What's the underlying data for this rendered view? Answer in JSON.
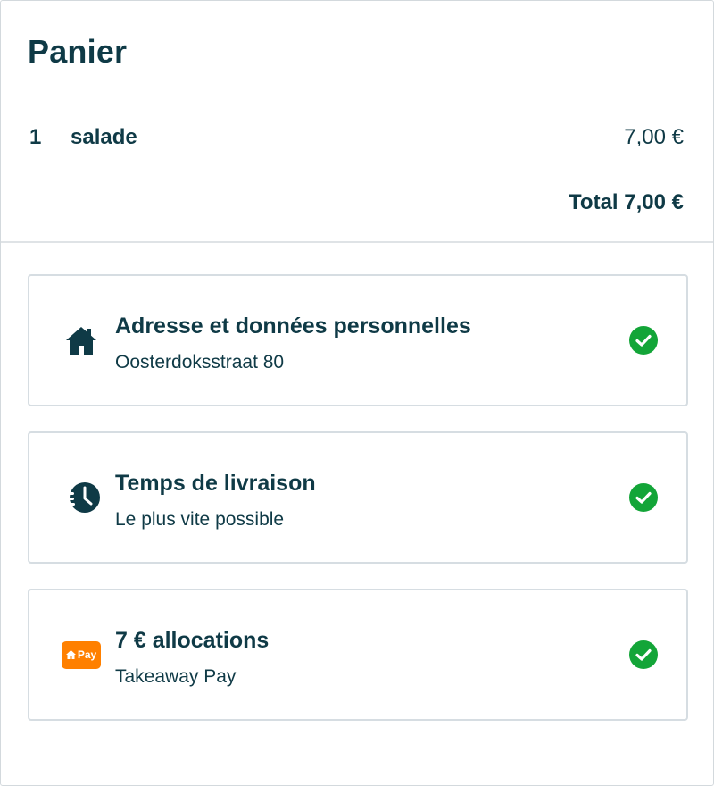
{
  "basket": {
    "title": "Panier",
    "items": [
      {
        "quantity": "1",
        "name": "salade",
        "price": "7,00 €"
      }
    ],
    "total": "Total 7,00 €"
  },
  "steps": [
    {
      "title": "Adresse et données personnelles",
      "subtitle": "Oosterdoksstraat 80",
      "icon": "house-icon",
      "status": "complete"
    },
    {
      "title": "Temps de livraison",
      "subtitle": "Le plus vite possible",
      "icon": "fast-clock-icon",
      "status": "complete"
    },
    {
      "title": "7 € allocations",
      "subtitle": "Takeaway Pay",
      "icon": "takeaway-pay-icon",
      "icon_label": "Pay",
      "status": "complete"
    }
  ],
  "colors": {
    "text": "#0f3a46",
    "check": "#13a538",
    "pay_badge": "#ff8000",
    "border": "#d6dde2"
  }
}
